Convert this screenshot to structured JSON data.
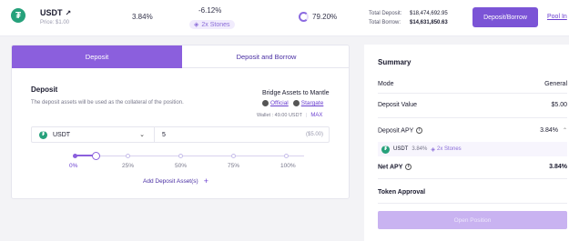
{
  "topbar": {
    "asset_symbol": "USDT",
    "external_link_glyph": "↗",
    "price": "Price: $1.00",
    "supply_apy": "3.84%",
    "borrow_apy": "-6.12%",
    "stones_label": "2x Stones",
    "utilization": "79.20%",
    "total_deposit_label": "Total Deposit:",
    "total_deposit_value": "$18,474,692.95",
    "total_borrow_label": "Total Borrow:",
    "total_borrow_value": "$14,631,850.63",
    "deposit_borrow_button": "Deposit/Borrow",
    "pool_info_link": "Pool In",
    "utilization_fraction": 0.792
  },
  "tabs": {
    "deposit": "Deposit",
    "deposit_and_borrow": "Deposit and Borrow"
  },
  "deposit": {
    "title": "Deposit",
    "description": "The deposit assets will be used as the collateral of the position.",
    "bridge_title": "Bridge Assets to Mantle",
    "official_link": "Official",
    "stargate_link": "Stargate",
    "wallet_text": "Wallet : 49.00 USDT",
    "max_label": "MAX",
    "token_symbol": "USDT",
    "amount_value": "5",
    "amount_usd": "($5.00)",
    "slider_labels": [
      "0%",
      "25%",
      "50%",
      "75%",
      "100%"
    ],
    "slider_fraction": 0.1,
    "add_asset_label": "Add Deposit Asset(s)",
    "plus_glyph": "+"
  },
  "summary": {
    "title": "Summary",
    "mode_label": "Mode",
    "mode_value": "General",
    "deposit_value_label": "Deposit Value",
    "deposit_value": "$5.00",
    "deposit_apy_label": "Deposit APY",
    "deposit_apy_value": "3.84%",
    "apy_token": "USDT",
    "apy_token_pct": "3.84%",
    "apy_stones": "2x Stones",
    "net_apy_label": "Net APY",
    "net_apy_value": "3.84%",
    "token_approval_label": "Token Approval",
    "open_position_button": "Open Position"
  },
  "icons": [
    "usdt-icon",
    "external-link-icon",
    "stones-icon",
    "utilization-ring-icon",
    "chevron-down-icon",
    "info-icon",
    "chevron-up-icon",
    "plus-icon",
    "official-bridge-icon",
    "stargate-icon"
  ],
  "colors": {
    "accent": "#7b54d6",
    "tab_active": "#8b5fdd",
    "usdt_green": "#26a17b",
    "disabled_button": "#c9b3f1"
  }
}
